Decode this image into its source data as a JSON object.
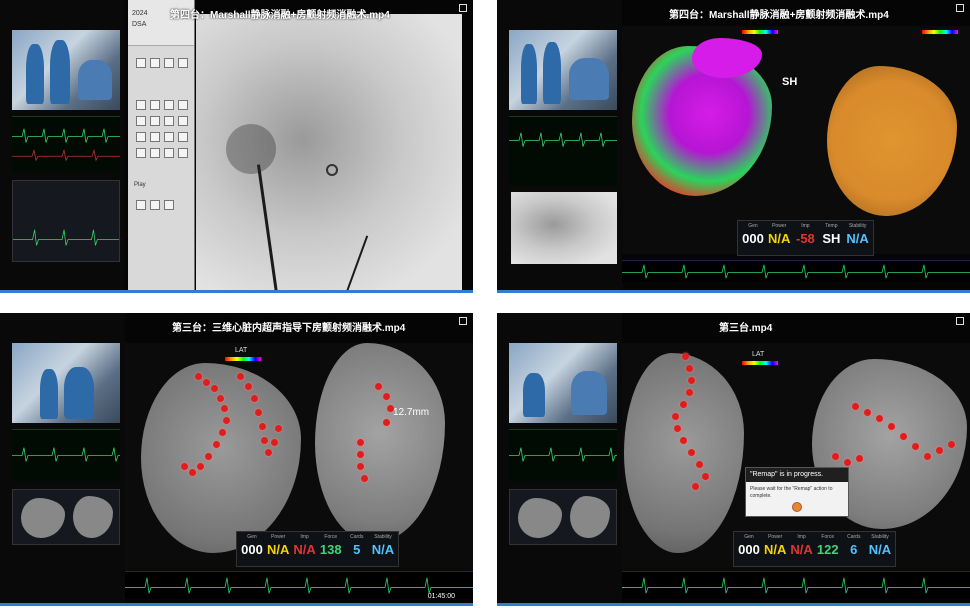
{
  "panels": {
    "p1": {
      "title": "第四台：Marshall静脉消融+房颤射频消融术.mp4",
      "tool_header": [
        "2024",
        "DSA"
      ],
      "tool_label": "Play"
    },
    "p2": {
      "title": "第四台：Marshall静脉消融+房颤射频消融术.mp4",
      "vitals": [
        {
          "label": "Gen",
          "value": "000",
          "color": "white"
        },
        {
          "label": "Power",
          "value": "N/A",
          "color": "yellow"
        },
        {
          "label": "Imp",
          "value": "-58",
          "color": "red"
        },
        {
          "label": "Temp",
          "value": "SH",
          "color": "white"
        },
        {
          "label": "Stability",
          "value": "N/A",
          "color": "cyan"
        }
      ],
      "sh_label": "SH"
    },
    "p3": {
      "title": "第三台：三维心脏内超声指导下房颤射频消融术.mp4",
      "lat_label": "LAT",
      "distance": "12.7mm",
      "timecode": "01:45:00",
      "vitals": [
        {
          "label": "Gen",
          "value": "000",
          "color": "white"
        },
        {
          "label": "Power",
          "value": "N/A",
          "color": "yellow"
        },
        {
          "label": "Imp",
          "value": "N/A",
          "color": "red"
        },
        {
          "label": "Force",
          "value": "138",
          "color": "green"
        },
        {
          "label": "Cards",
          "value": "5",
          "color": "cyan"
        },
        {
          "label": "Stability",
          "value": "N/A",
          "color": "cyan"
        }
      ]
    },
    "p4": {
      "title": "第三台.mp4",
      "lat_label": "LAT",
      "dialog": {
        "heading": "\"Remap\" is in progress.",
        "body": "Please wait for the \"Remap\" action to complete."
      },
      "vitals": [
        {
          "label": "Gen",
          "value": "000",
          "color": "white"
        },
        {
          "label": "Power",
          "value": "N/A",
          "color": "yellow"
        },
        {
          "label": "Imp",
          "value": "N/A",
          "color": "red"
        },
        {
          "label": "Force",
          "value": "122",
          "color": "green"
        },
        {
          "label": "Cards",
          "value": "6",
          "color": "cyan"
        },
        {
          "label": "Stability",
          "value": "N/A",
          "color": "cyan"
        }
      ]
    }
  },
  "colors": {
    "progress": "#2f7fd1",
    "catheter_dot": "#e01d1d",
    "mesh_gray": "#8c8c8c",
    "mesh_orange": "#d98a2b"
  }
}
